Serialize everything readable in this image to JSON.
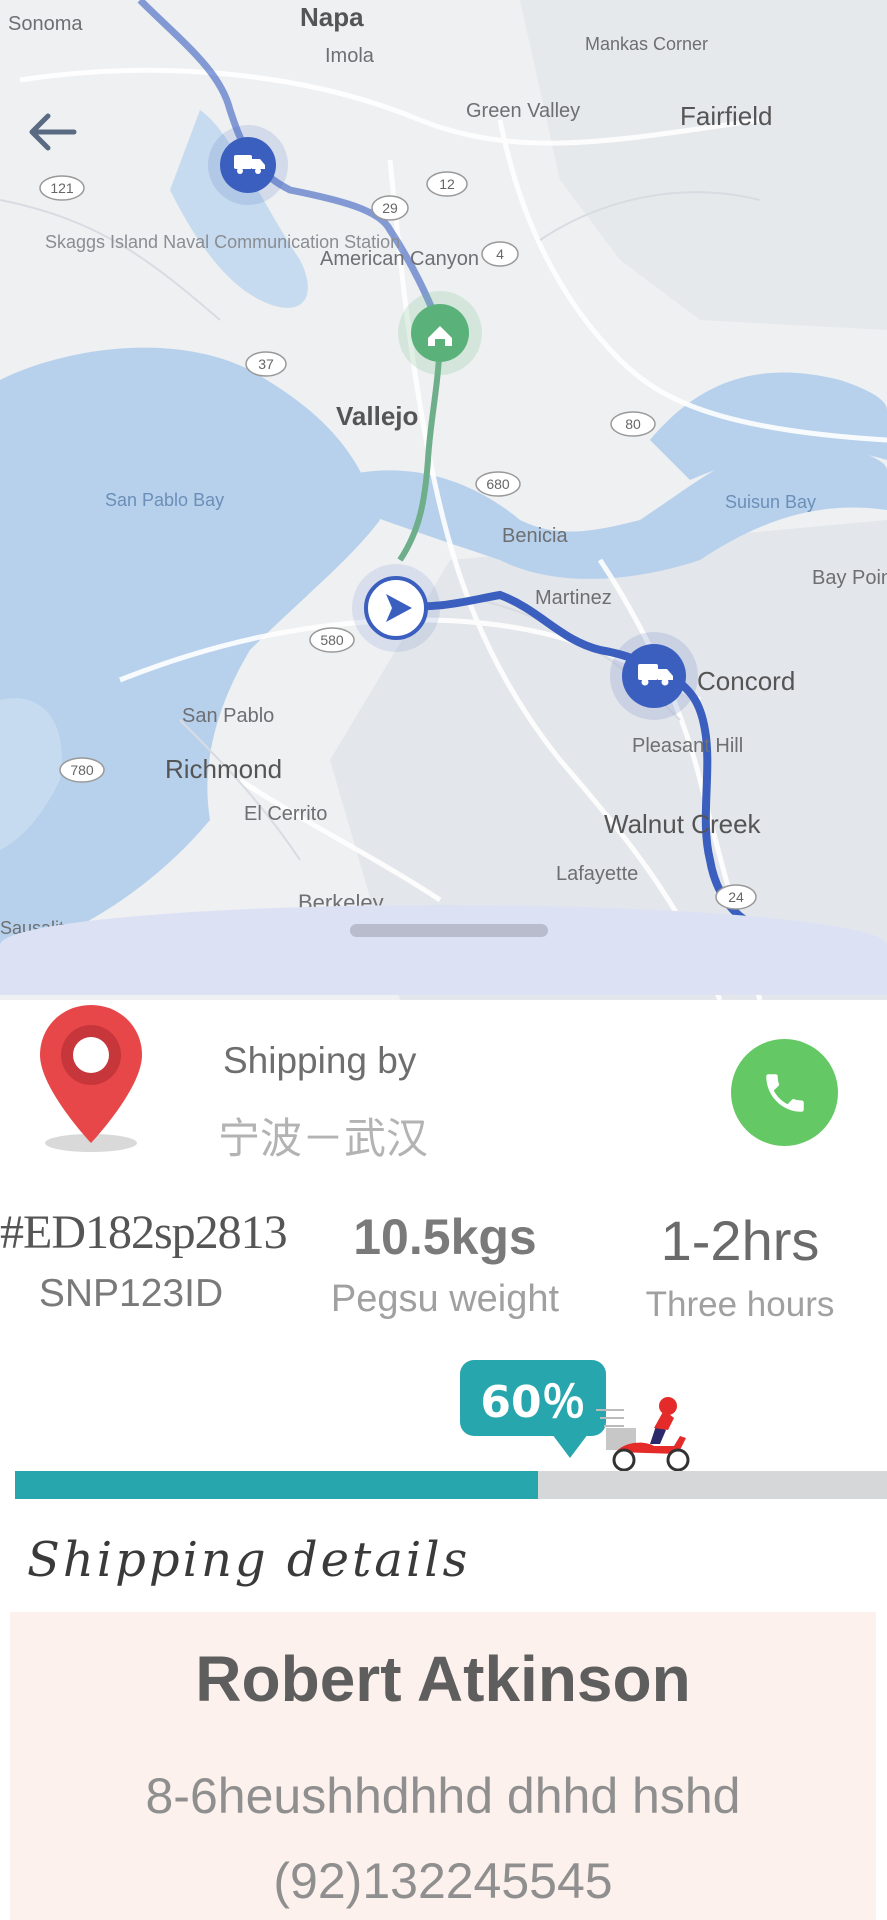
{
  "map": {
    "labels": [
      "Sonoma",
      "Napa",
      "Imola",
      "Mankas Corner",
      "Green Valley",
      "Fairfield",
      "Skaggs Island Naval Communication Station",
      "American Canyon",
      "Vallejo",
      "San Pablo Bay",
      "Benicia",
      "Suisun Bay",
      "Bay Point",
      "Martinez",
      "Concord",
      "Pleasant Hill",
      "San Pablo",
      "Richmond",
      "El Cerrito",
      "Walnut Creek",
      "Lafayette",
      "Berkeley",
      "Sausalito"
    ],
    "road_shields": [
      "121",
      "12",
      "29",
      "37",
      "80",
      "680",
      "780",
      "4",
      "580",
      "24"
    ],
    "colors": {
      "water": "#b7d1ec",
      "land": "#eef0f2",
      "route": "#3b5fbf",
      "route_alt": "#6fae8a"
    }
  },
  "back_icon": "arrow-left-icon",
  "shipping": {
    "by_label": "Shipping by",
    "route": "宁波－武汉",
    "pin_icon": "map-pin-icon",
    "call_icon": "phone-icon"
  },
  "stats": {
    "tracking_id": "#ED182sp2813",
    "tracking_sub": "SNP123ID",
    "weight": "10.5kgs",
    "weight_label": "Pegsu weight",
    "duration": "1-2hrs",
    "duration_label": "Three hours"
  },
  "progress": {
    "value": 60,
    "label": "60％",
    "color": "#27a6ad"
  },
  "details": {
    "title": "Shipping details",
    "name": "Robert Atkinson",
    "address": "8-6heushhdhhd dhhd hshd",
    "phone": "(92)132245545"
  }
}
